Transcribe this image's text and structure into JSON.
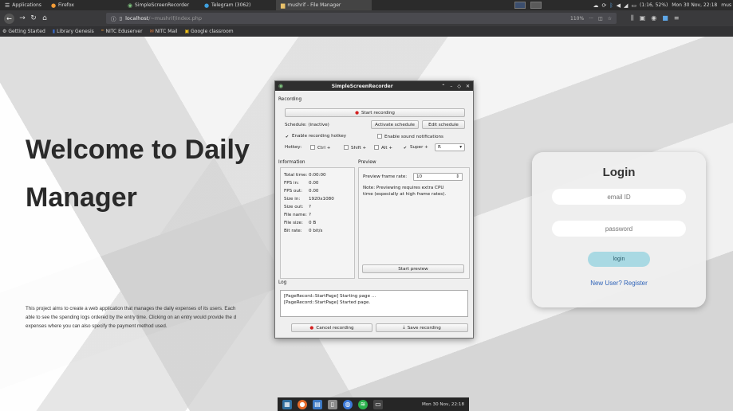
{
  "system_bar": {
    "apps_menu": "Applications",
    "tasks": [
      {
        "label": "Firefox",
        "icon": "firefox-icon"
      },
      {
        "label": "SimpleScreenRecorder",
        "icon": "recorder-icon"
      },
      {
        "label": "Telegram (3062)",
        "icon": "telegram-icon"
      },
      {
        "label": "mushrif - File Manager",
        "icon": "folder-icon"
      }
    ],
    "battery": "(1:16, 52%)",
    "clock": "Mon 30 Nov, 22:18",
    "user": "mus"
  },
  "browser": {
    "url_host": "localhost",
    "url_path": "/~mushrif/index.php",
    "zoom": "110%",
    "bookmarks": [
      {
        "label": "Getting Started",
        "icon": "gear-icon"
      },
      {
        "label": "Library Genesis",
        "icon": "book-icon"
      },
      {
        "label": "NITC Eduserver",
        "icon": "moodle-icon"
      },
      {
        "label": "NITC Mail",
        "icon": "mail-icon"
      },
      {
        "label": "Google classroom",
        "icon": "classroom-icon"
      }
    ]
  },
  "page": {
    "hero_line1": "Welcome to Daily",
    "hero_line2": "Manager",
    "description_line1": "This project aims to create a web application that manages the daily expenses of its users. Each",
    "description_line2": "able to see the spending logs ordered by the entry time. Clicking on an entry would provide the d",
    "description_line3": "expenses where you can also specify the payment method used.",
    "login": {
      "title": "Login",
      "email_placeholder": "email ID",
      "password_placeholder": "password",
      "button": "login",
      "register_link": "New User? Register"
    }
  },
  "recorder": {
    "title": "SimpleScreenRecorder",
    "recording_label": "Recording",
    "start_button": "Start recording",
    "schedule_label": "Schedule: (inactive)",
    "activate_schedule": "Activate schedule",
    "edit_schedule": "Edit schedule",
    "enable_hotkey": "Enable recording hotkey",
    "enable_sound": "Enable sound notifications",
    "hotkey_label": "Hotkey:",
    "modifiers": [
      {
        "label": "Ctrl +",
        "checked": false
      },
      {
        "label": "Shift +",
        "checked": false
      },
      {
        "label": "Alt +",
        "checked": false
      },
      {
        "label": "Super +",
        "checked": true
      }
    ],
    "hotkey_key": "R",
    "information_label": "Information",
    "preview_label": "Preview",
    "info": [
      {
        "key": "Total time:",
        "value": "0:00:00"
      },
      {
        "key": "FPS in:",
        "value": "0.00"
      },
      {
        "key": "FPS out:",
        "value": "0.00"
      },
      {
        "key": "Size in:",
        "value": "1920x1080"
      },
      {
        "key": "Size out:",
        "value": "?"
      },
      {
        "key": "File name:",
        "value": "?"
      },
      {
        "key": "File size:",
        "value": "0 B"
      },
      {
        "key": "Bit rate:",
        "value": "0 bit/s"
      }
    ],
    "preview_frame_rate_label": "Preview frame rate:",
    "preview_frame_rate": "10",
    "preview_note_line1": "Note: Previewing requires extra CPU",
    "preview_note_line2": "time (especially at high frame rates).",
    "start_preview": "Start preview",
    "log_label": "Log",
    "log_lines": [
      "[PageRecord::StartPage] Starting page ...",
      "[PageRecord::StartPage] Started page."
    ],
    "cancel_button": "Cancel recording",
    "save_button": "Save recording"
  },
  "dock": {
    "clock": "Mon 30 Nov, 22:18"
  }
}
